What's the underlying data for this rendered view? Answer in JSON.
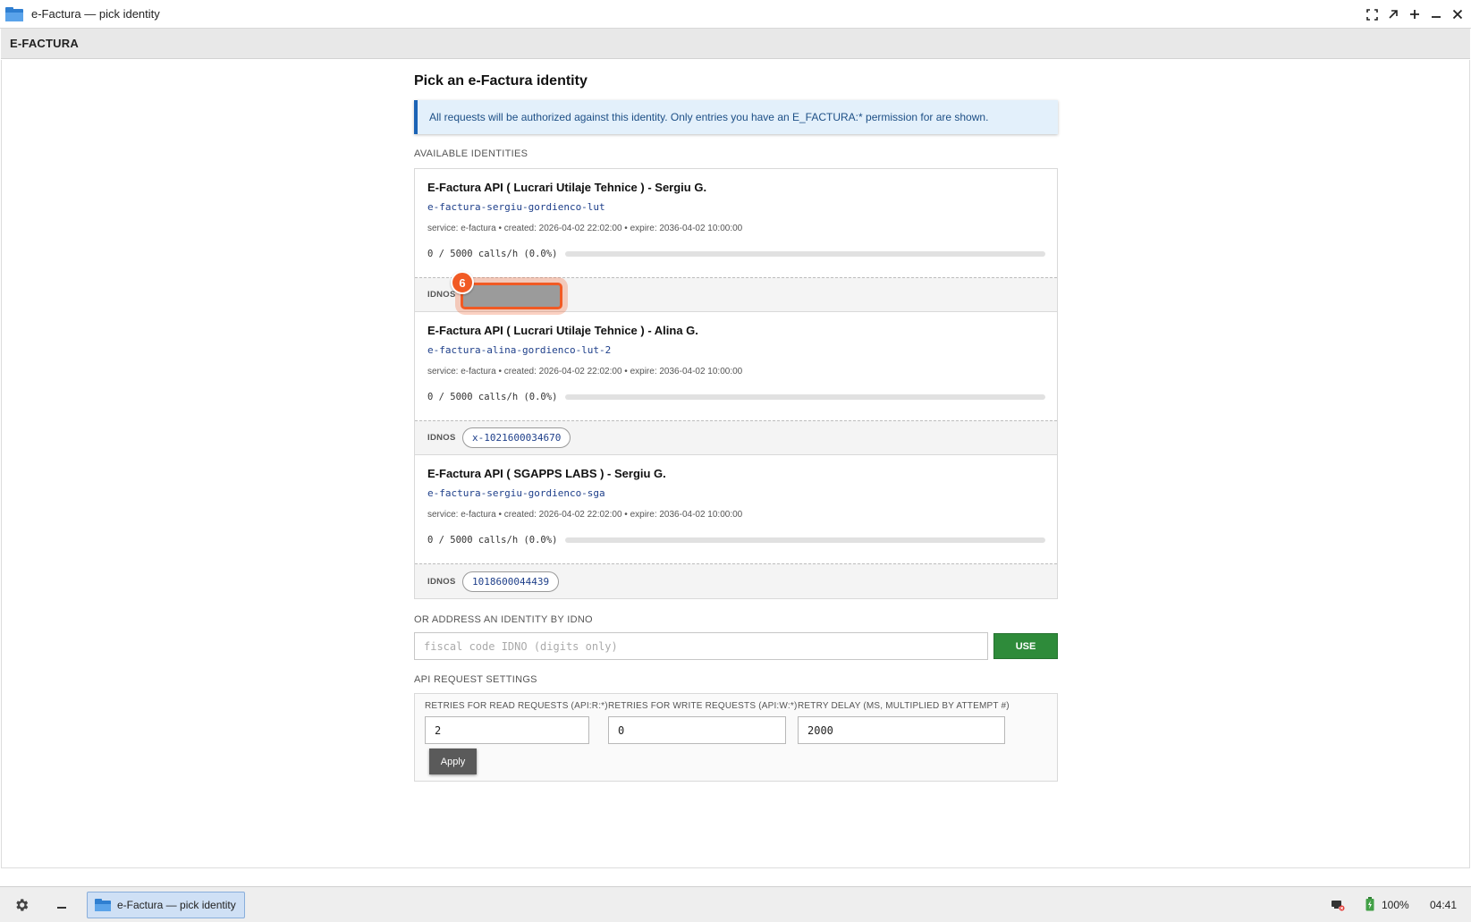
{
  "window": {
    "title": "e-Factura — pick identity"
  },
  "appbar": {
    "title": "E-FACTURA"
  },
  "page": {
    "title": "Pick an e-Factura identity",
    "info": "All requests will be authorized against this identity. Only entries you have an E_FACTURA:* permission for are shown.",
    "available_label": "AVAILABLE IDENTITIES",
    "idnos_label": "IDNOS"
  },
  "identities": [
    {
      "name": "E-Factura API ( Lucrari Utilaje Tehnice ) - Sergiu G.",
      "slug": "e-factura-sergiu-gordienco-lut",
      "meta": "service: e-factura • created: 2026-04-02 22:02:00 • expire: 2036-04-02 10:00:00",
      "usage": "0 / 5000 calls/h (0.0%)",
      "usage_fraction": 0.0,
      "idno": ""
    },
    {
      "name": "E-Factura API ( Lucrari Utilaje Tehnice ) - Alina G.",
      "slug": "e-factura-alina-gordienco-lut-2",
      "meta": "service: e-factura • created: 2026-04-02 22:02:00 • expire: 2036-04-02 10:00:00",
      "usage": "0 / 5000 calls/h (0.0%)",
      "usage_fraction": 0.0,
      "idno": "x-1021600034670"
    },
    {
      "name": "E-Factura API ( SGAPPS LABS ) - Sergiu G.",
      "slug": "e-factura-sergiu-gordienco-sga",
      "meta": "service: e-factura • created: 2026-04-02 22:02:00 • expire: 2036-04-02 10:00:00",
      "usage": "0 / 5000 calls/h (0.0%)",
      "usage_fraction": 0.0,
      "idno": "1018600044439"
    }
  ],
  "step_badge": "6",
  "address": {
    "label": "OR ADDRESS AN IDENTITY BY IDNO",
    "placeholder": "fiscal code IDNO (digits only)",
    "button": "USE"
  },
  "settings": {
    "label": "API REQUEST SETTINGS",
    "read_label": "RETRIES FOR READ REQUESTS (API:R:*)",
    "read_value": "2",
    "write_label": "RETRIES FOR WRITE REQUESTS (API:W:*)",
    "write_value": "0",
    "delay_label": "RETRY DELAY (MS, MULTIPLIED BY ATTEMPT #)",
    "delay_value": "2000",
    "apply": "Apply"
  },
  "taskbar": {
    "task_label": "e-Factura — pick identity",
    "battery": "100%",
    "clock": "04:41"
  },
  "colors": {
    "accent_blue": "#1b63b5",
    "use_green": "#2e8b3a",
    "highlight_orange": "#f15a24"
  }
}
